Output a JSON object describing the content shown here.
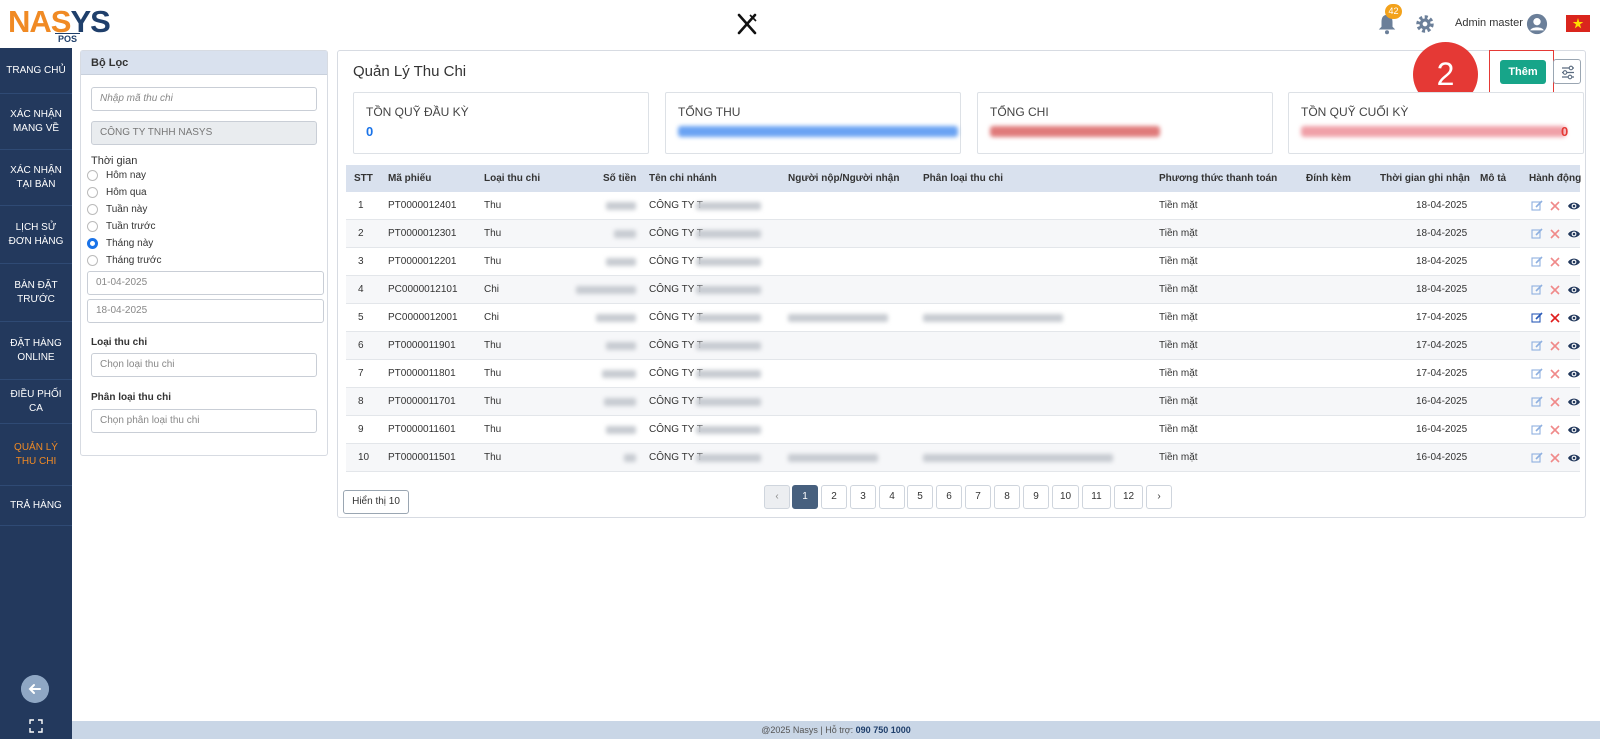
{
  "header": {
    "logo_main": "NASYS",
    "logo_sub": "POS",
    "notification_count": "42",
    "admin_name": "Admin master"
  },
  "sidebar": {
    "items": [
      {
        "label": "TRANG CHỦ"
      },
      {
        "label": "XÁC NHẬN MANG VỀ"
      },
      {
        "label": "XÁC NHẬN TẠI BÀN"
      },
      {
        "label": "LỊCH SỬ ĐƠN HÀNG"
      },
      {
        "label": "BÀN ĐẶT TRƯỚC"
      },
      {
        "label": "ĐẶT HÀNG ONLINE"
      },
      {
        "label": "ĐIỀU PHỐI CA"
      },
      {
        "label": "QUẢN LÝ THU CHI"
      },
      {
        "label": "TRẢ HÀNG"
      }
    ],
    "active_index": 7
  },
  "filter": {
    "title": "Bộ Lọc",
    "code_placeholder": "Nhập mã thu chi",
    "company": "CÔNG TY TNHH NASYS",
    "time_label": "Thời gian",
    "time_options": [
      "Hôm nay",
      "Hôm qua",
      "Tuần này",
      "Tuần trước",
      "Tháng này",
      "Tháng trước"
    ],
    "time_selected": "Tháng này",
    "date_from": "01-04-2025",
    "date_to": "18-04-2025",
    "type_label": "Loại thu chi",
    "type_placeholder": "Chọn loại thu chi",
    "category_label": "Phân loại thu chi",
    "category_placeholder": "Chọn phân loại thu chi"
  },
  "main": {
    "title": "Quản Lý Thu Chi",
    "add_label": "Thêm",
    "step_number": "2",
    "cards": [
      {
        "title": "TỒN QUỸ ĐẦU KỲ",
        "value": "0"
      },
      {
        "title": "TỔNG THU",
        "value": ""
      },
      {
        "title": "TỔNG CHI",
        "value": ""
      },
      {
        "title": "TỒN QUỸ CUỐI KỲ",
        "value": "0"
      }
    ]
  },
  "table": {
    "headers": [
      "STT",
      "Mã phiếu",
      "Loại thu chi",
      "Số tiền",
      "Tên chi nhánh",
      "Người nộp/Người nhận",
      "Phân loại thu chi",
      "Phương thức thanh toán",
      "Đính kèm",
      "Thời gian ghi nhận",
      "Mô tả",
      "Hành động"
    ],
    "rows": [
      {
        "stt": "1",
        "code": "PT0000012401",
        "type": "Thu",
        "branch": "CÔNG TY T",
        "method": "Tiền mặt",
        "date": "18-04-2025"
      },
      {
        "stt": "2",
        "code": "PT0000012301",
        "type": "Thu",
        "branch": "CÔNG TY T",
        "method": "Tiền mặt",
        "date": "18-04-2025"
      },
      {
        "stt": "3",
        "code": "PT0000012201",
        "type": "Thu",
        "branch": "CÔNG TY T",
        "method": "Tiền mặt",
        "date": "18-04-2025"
      },
      {
        "stt": "4",
        "code": "PC0000012101",
        "type": "Chi",
        "branch": "CÔNG TY T",
        "method": "Tiền mặt",
        "date": "18-04-2025"
      },
      {
        "stt": "5",
        "code": "PC0000012001",
        "type": "Chi",
        "branch": "CÔNG TY T",
        "method": "Tiền mặt",
        "date": "17-04-2025"
      },
      {
        "stt": "6",
        "code": "PT0000011901",
        "type": "Thu",
        "branch": "CÔNG TY T",
        "method": "Tiền mặt",
        "date": "17-04-2025"
      },
      {
        "stt": "7",
        "code": "PT0000011801",
        "type": "Thu",
        "branch": "CÔNG TY T",
        "method": "Tiền mặt",
        "date": "17-04-2025"
      },
      {
        "stt": "8",
        "code": "PT0000011701",
        "type": "Thu",
        "branch": "CÔNG TY T",
        "method": "Tiền mặt",
        "date": "16-04-2025"
      },
      {
        "stt": "9",
        "code": "PT0000011601",
        "type": "Thu",
        "branch": "CÔNG TY T",
        "method": "Tiền mặt",
        "date": "16-04-2025"
      },
      {
        "stt": "10",
        "code": "PT0000011501",
        "type": "Thu",
        "branch": "CÔNG TY T",
        "method": "Tiền mặt",
        "date": "16-04-2025"
      }
    ]
  },
  "pagination": {
    "page_size_label": "Hiển thị 10",
    "prev": "‹",
    "next": "›",
    "pages": [
      "1",
      "2",
      "3",
      "4",
      "5",
      "6",
      "7",
      "8",
      "9",
      "10",
      "11",
      "12"
    ],
    "current": "1"
  },
  "footer": {
    "text": "@2025 Nasys | Hỗ trợ: ",
    "phone": "090 750 1000"
  },
  "colors": {
    "sidebar_bg": "#23395d",
    "accent_orange": "#f08a24",
    "add_button": "#17a589",
    "highlight_red": "#e53935",
    "table_header": "#d9e1ee"
  },
  "icons": {
    "center": "utensils-icon",
    "bell": "bell-icon",
    "settings": "gear-icon",
    "avatar": "user-circle-icon",
    "flag": "vietnam-flag-icon",
    "back": "arrow-left-icon",
    "expand": "expand-icon",
    "row_edit": "edit-icon",
    "row_delete": "delete-icon",
    "row_view": "eye-icon",
    "column_settings": "sliders-icon"
  }
}
